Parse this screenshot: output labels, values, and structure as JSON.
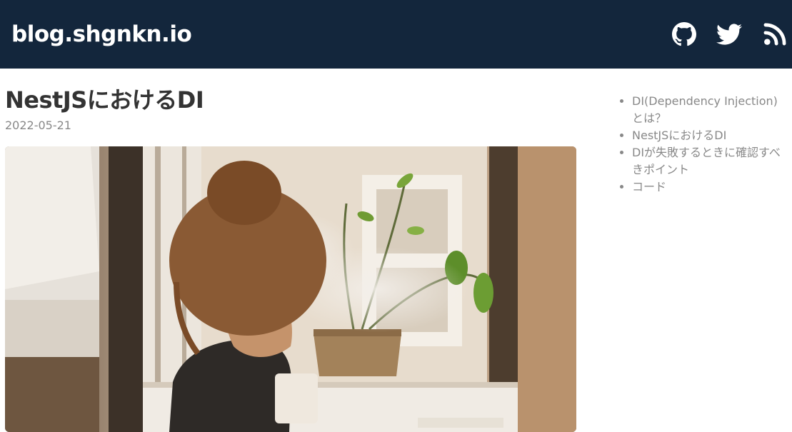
{
  "header": {
    "site_title": "blog.shgnkn.io",
    "background_color": "#13263c",
    "icons": [
      "github-icon",
      "twitter-icon",
      "rss-icon"
    ]
  },
  "post": {
    "title": "NestJSにおけるDI",
    "date": "2022-05-21"
  },
  "toc": {
    "items": [
      {
        "label": "DI(Dependency Injection)とは？"
      },
      {
        "label": "NestJSにおけるDI"
      },
      {
        "label": "DIが失敗するときに確認すべきポイント"
      },
      {
        "label": "コード"
      }
    ]
  }
}
